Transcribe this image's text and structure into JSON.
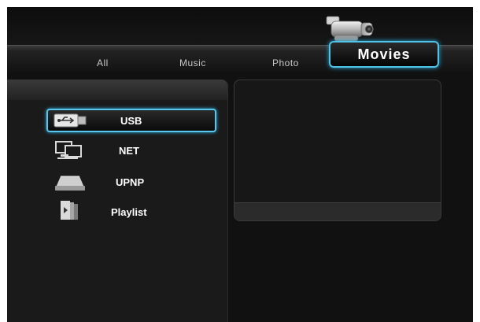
{
  "tabs": [
    {
      "label": "All"
    },
    {
      "label": "Music"
    },
    {
      "label": "Photo"
    },
    {
      "label": "Movies"
    }
  ],
  "active_tab": "Movies",
  "sources": [
    {
      "label": "USB",
      "icon": "usb-icon",
      "selected": true
    },
    {
      "label": "NET",
      "icon": "network-computers-icon",
      "selected": false
    },
    {
      "label": "UPNP",
      "icon": "upnp-drive-icon",
      "selected": false
    },
    {
      "label": "Playlist",
      "icon": "playlist-icon",
      "selected": false
    }
  ],
  "colors": {
    "accent": "#4fc3e8",
    "background": "#111111"
  }
}
